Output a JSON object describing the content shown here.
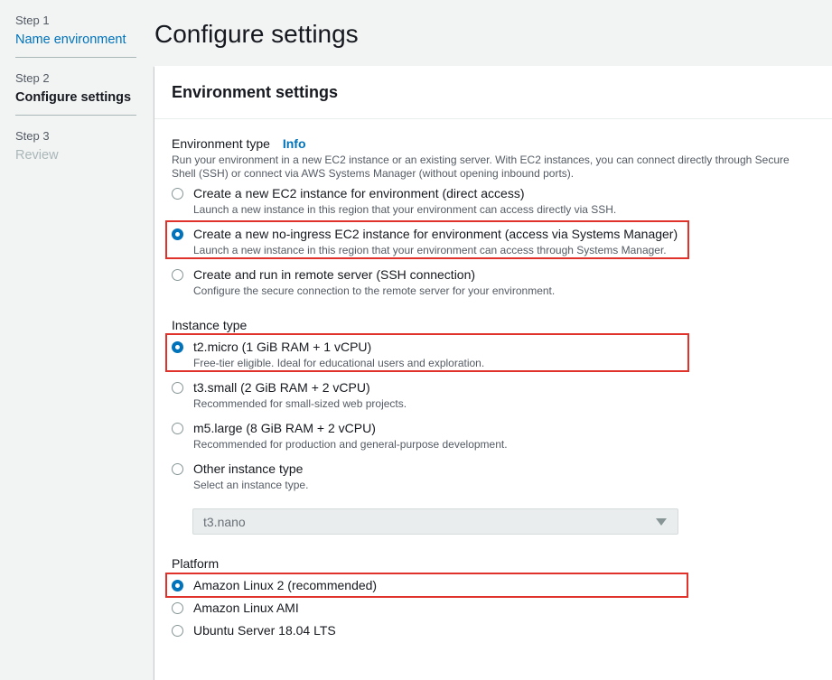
{
  "steps": [
    {
      "num": "Step 1",
      "title": "Name environment"
    },
    {
      "num": "Step 2",
      "title": "Configure settings"
    },
    {
      "num": "Step 3",
      "title": "Review"
    }
  ],
  "page_title": "Configure settings",
  "panel": {
    "title": "Environment settings",
    "environment_type": {
      "label": "Environment type",
      "info": "Info",
      "description": "Run your environment in a new EC2 instance or an existing server. With EC2 instances, you can connect directly through Secure Shell (SSH) or connect via AWS Systems Manager (without opening inbound ports).",
      "options": [
        {
          "label": "Create a new EC2 instance for environment (direct access)",
          "desc": "Launch a new instance in this region that your environment can access directly via SSH."
        },
        {
          "label": "Create a new no-ingress EC2 instance for environment (access via Systems Manager)",
          "desc": "Launch a new instance in this region that your environment can access through Systems Manager."
        },
        {
          "label": "Create and run in remote server (SSH connection)",
          "desc": "Configure the secure connection to the remote server for your environment."
        }
      ]
    },
    "instance_type": {
      "label": "Instance type",
      "options": [
        {
          "label": "t2.micro (1 GiB RAM + 1 vCPU)",
          "desc": "Free-tier eligible. Ideal for educational users and exploration."
        },
        {
          "label": "t3.small (2 GiB RAM + 2 vCPU)",
          "desc": "Recommended for small-sized web projects."
        },
        {
          "label": "m5.large (8 GiB RAM + 2 vCPU)",
          "desc": "Recommended for production and general-purpose development."
        },
        {
          "label": "Other instance type",
          "desc": "Select an instance type."
        }
      ],
      "select_value": "t3.nano"
    },
    "platform": {
      "label": "Platform",
      "options": [
        {
          "label": "Amazon Linux 2 (recommended)"
        },
        {
          "label": "Amazon Linux AMI"
        },
        {
          "label": "Ubuntu Server 18.04 LTS"
        }
      ]
    }
  },
  "colors": {
    "accent": "#0073bb",
    "highlight": "#e0322a"
  }
}
